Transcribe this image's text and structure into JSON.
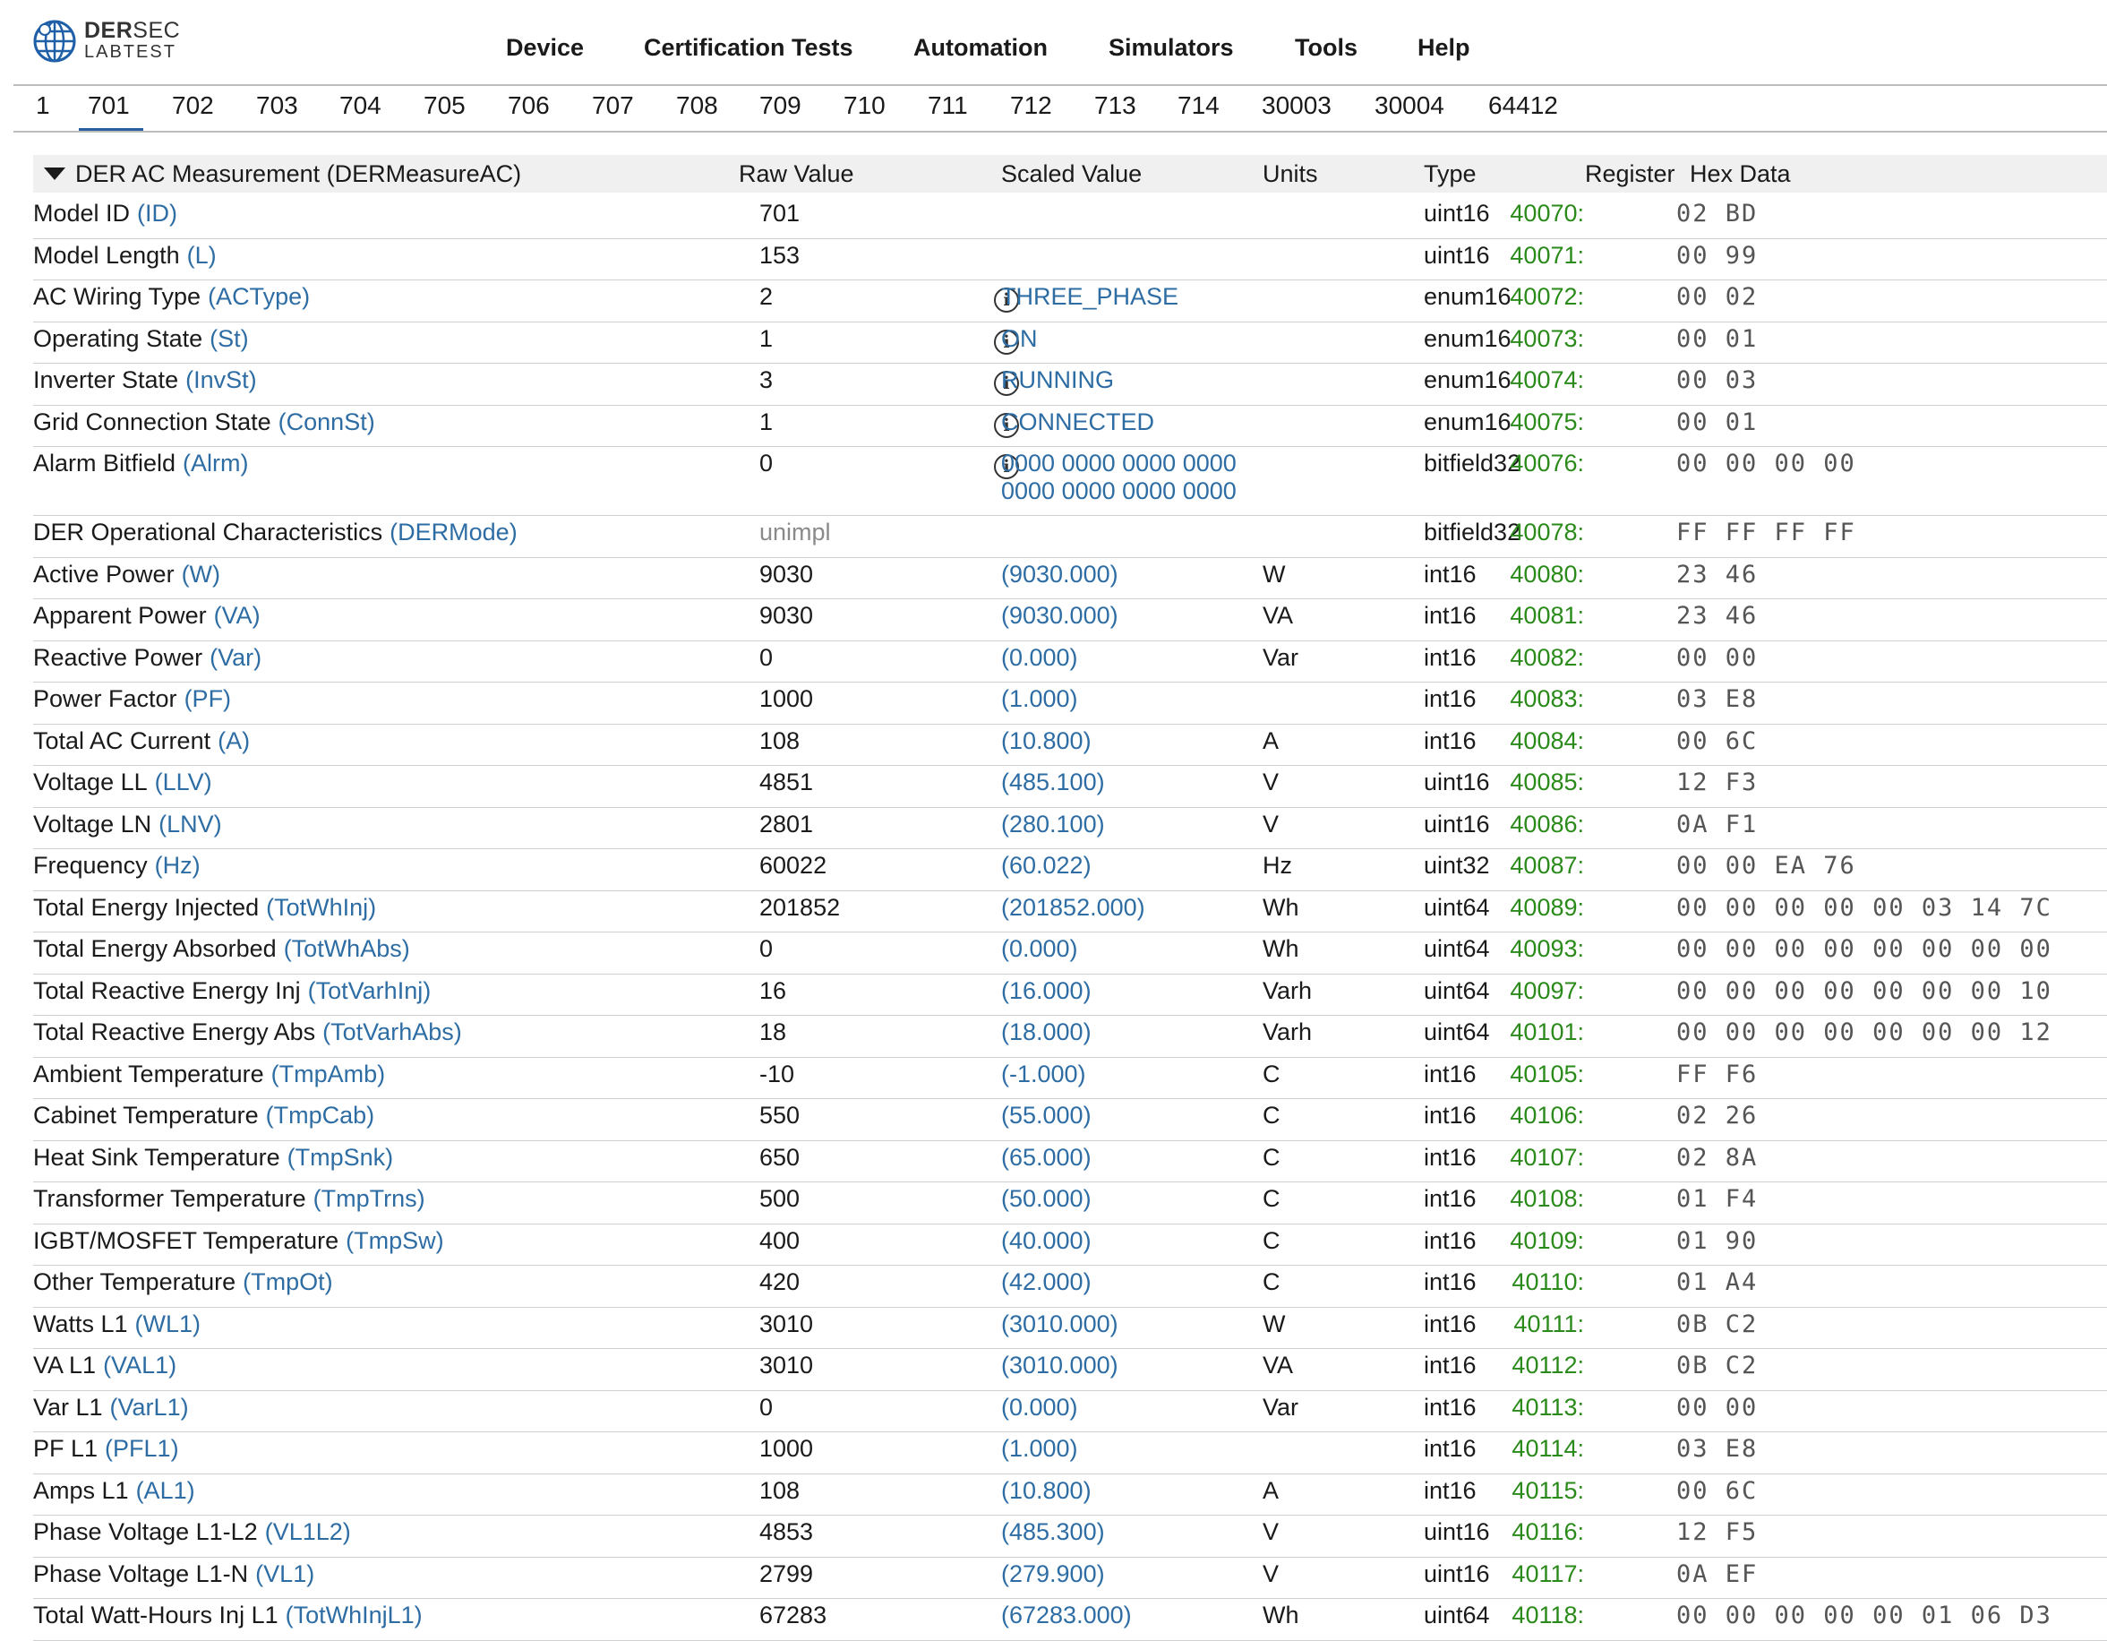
{
  "logo": {
    "line1_bold": "DER",
    "line1_light": "SEC",
    "line2": "LABTEST"
  },
  "nav": [
    "Device",
    "Certification Tests",
    "Automation",
    "Simulators",
    "Tools",
    "Help"
  ],
  "tabs": [
    "1",
    "701",
    "702",
    "703",
    "704",
    "705",
    "706",
    "707",
    "708",
    "709",
    "710",
    "711",
    "712",
    "713",
    "714",
    "30003",
    "30004",
    "64412"
  ],
  "active_tab": "701",
  "section": {
    "title": "DER AC Measurement (DERMeasureAC)",
    "columns": {
      "raw": "Raw Value",
      "scaled": "Scaled Value",
      "units": "Units",
      "type": "Type",
      "register": "Register",
      "hex": "Hex Data"
    }
  },
  "rows": [
    {
      "name": "Model ID",
      "id": "(ID)",
      "raw": "701",
      "scaled": "",
      "units": "",
      "type": "uint16",
      "reg": "40070:",
      "hex": "02 BD"
    },
    {
      "name": "Model Length",
      "id": "(L)",
      "raw": "153",
      "scaled": "",
      "units": "",
      "type": "uint16",
      "reg": "40071:",
      "hex": "00 99"
    },
    {
      "name": "AC Wiring Type",
      "id": "(ACType)",
      "raw": "2",
      "scaled": "THREE_PHASE",
      "info": true,
      "units": "",
      "type": "enum16",
      "reg": "40072:",
      "hex": "00 02"
    },
    {
      "name": "Operating State",
      "id": "(St)",
      "raw": "1",
      "scaled": "ON",
      "info": true,
      "units": "",
      "type": "enum16",
      "reg": "40073:",
      "hex": "00 01"
    },
    {
      "name": "Inverter State",
      "id": "(InvSt)",
      "raw": "3",
      "scaled": "RUNNING",
      "info": true,
      "units": "",
      "type": "enum16",
      "reg": "40074:",
      "hex": "00 03"
    },
    {
      "name": "Grid Connection State",
      "id": "(ConnSt)",
      "raw": "1",
      "scaled": "CONNECTED",
      "info": true,
      "units": "",
      "type": "enum16",
      "reg": "40075:",
      "hex": "00 01"
    },
    {
      "name": "Alarm Bitfield",
      "id": "(Alrm)",
      "raw": "0",
      "scaled": "0000 0000 0000 0000",
      "scaled2": "0000 0000 0000 0000",
      "info": true,
      "units": "",
      "type": "bitfield32",
      "reg": "40076:",
      "hex": "00 00 00 00"
    },
    {
      "name": "DER Operational Characteristics",
      "id": "(DERMode)",
      "raw": "unimpl",
      "unimpl": true,
      "scaled": "",
      "units": "",
      "type": "bitfield32",
      "reg": "40078:",
      "hex": "FF FF FF FF"
    },
    {
      "name": "Active Power",
      "id": "(W)",
      "raw": "9030",
      "scaled": "(9030.000)",
      "units": "W",
      "type": "int16",
      "reg": "40080:",
      "hex": "23 46"
    },
    {
      "name": "Apparent Power",
      "id": "(VA)",
      "raw": "9030",
      "scaled": "(9030.000)",
      "units": "VA",
      "type": "int16",
      "reg": "40081:",
      "hex": "23 46"
    },
    {
      "name": "Reactive Power",
      "id": "(Var)",
      "raw": "0",
      "scaled": "(0.000)",
      "units": "Var",
      "type": "int16",
      "reg": "40082:",
      "hex": "00 00"
    },
    {
      "name": "Power Factor",
      "id": "(PF)",
      "raw": "1000",
      "scaled": "(1.000)",
      "units": "",
      "type": "int16",
      "reg": "40083:",
      "hex": "03 E8"
    },
    {
      "name": "Total AC Current",
      "id": "(A)",
      "raw": "108",
      "scaled": "(10.800)",
      "units": "A",
      "type": "int16",
      "reg": "40084:",
      "hex": "00 6C"
    },
    {
      "name": "Voltage LL",
      "id": "(LLV)",
      "raw": "4851",
      "scaled": "(485.100)",
      "units": "V",
      "type": "uint16",
      "reg": "40085:",
      "hex": "12 F3"
    },
    {
      "name": "Voltage LN",
      "id": "(LNV)",
      "raw": "2801",
      "scaled": "(280.100)",
      "units": "V",
      "type": "uint16",
      "reg": "40086:",
      "hex": "0A F1"
    },
    {
      "name": "Frequency",
      "id": "(Hz)",
      "raw": "60022",
      "scaled": "(60.022)",
      "units": "Hz",
      "type": "uint32",
      "reg": "40087:",
      "hex": "00 00 EA 76"
    },
    {
      "name": "Total Energy Injected",
      "id": "(TotWhInj)",
      "raw": "201852",
      "scaled": "(201852.000)",
      "units": "Wh",
      "type": "uint64",
      "reg": "40089:",
      "hex": "00 00 00 00 00 03 14 7C"
    },
    {
      "name": "Total Energy Absorbed",
      "id": "(TotWhAbs)",
      "raw": "0",
      "scaled": "(0.000)",
      "units": "Wh",
      "type": "uint64",
      "reg": "40093:",
      "hex": "00 00 00 00 00 00 00 00"
    },
    {
      "name": "Total Reactive Energy Inj",
      "id": "(TotVarhInj)",
      "raw": "16",
      "scaled": "(16.000)",
      "units": "Varh",
      "type": "uint64",
      "reg": "40097:",
      "hex": "00 00 00 00 00 00 00 10"
    },
    {
      "name": "Total Reactive Energy Abs",
      "id": "(TotVarhAbs)",
      "raw": "18",
      "scaled": "(18.000)",
      "units": "Varh",
      "type": "uint64",
      "reg": "40101:",
      "hex": "00 00 00 00 00 00 00 12"
    },
    {
      "name": "Ambient Temperature",
      "id": "(TmpAmb)",
      "raw": "-10",
      "scaled": "(-1.000)",
      "units": "C",
      "type": "int16",
      "reg": "40105:",
      "hex": "FF F6"
    },
    {
      "name": "Cabinet Temperature",
      "id": "(TmpCab)",
      "raw": "550",
      "scaled": "(55.000)",
      "units": "C",
      "type": "int16",
      "reg": "40106:",
      "hex": "02 26"
    },
    {
      "name": "Heat Sink Temperature",
      "id": "(TmpSnk)",
      "raw": "650",
      "scaled": "(65.000)",
      "units": "C",
      "type": "int16",
      "reg": "40107:",
      "hex": "02 8A"
    },
    {
      "name": "Transformer Temperature",
      "id": "(TmpTrns)",
      "raw": "500",
      "scaled": "(50.000)",
      "units": "C",
      "type": "int16",
      "reg": "40108:",
      "hex": "01 F4"
    },
    {
      "name": "IGBT/MOSFET Temperature",
      "id": "(TmpSw)",
      "raw": "400",
      "scaled": "(40.000)",
      "units": "C",
      "type": "int16",
      "reg": "40109:",
      "hex": "01 90"
    },
    {
      "name": "Other Temperature",
      "id": "(TmpOt)",
      "raw": "420",
      "scaled": "(42.000)",
      "units": "C",
      "type": "int16",
      "reg": "40110:",
      "hex": "01 A4"
    },
    {
      "name": "Watts L1",
      "id": "(WL1)",
      "raw": "3010",
      "scaled": "(3010.000)",
      "units": "W",
      "type": "int16",
      "reg": "40111:",
      "hex": "0B C2"
    },
    {
      "name": "VA L1",
      "id": "(VAL1)",
      "raw": "3010",
      "scaled": "(3010.000)",
      "units": "VA",
      "type": "int16",
      "reg": "40112:",
      "hex": "0B C2"
    },
    {
      "name": "Var L1",
      "id": "(VarL1)",
      "raw": "0",
      "scaled": "(0.000)",
      "units": "Var",
      "type": "int16",
      "reg": "40113:",
      "hex": "00 00"
    },
    {
      "name": "PF L1",
      "id": "(PFL1)",
      "raw": "1000",
      "scaled": "(1.000)",
      "units": "",
      "type": "int16",
      "reg": "40114:",
      "hex": "03 E8"
    },
    {
      "name": "Amps L1",
      "id": "(AL1)",
      "raw": "108",
      "scaled": "(10.800)",
      "units": "A",
      "type": "int16",
      "reg": "40115:",
      "hex": "00 6C"
    },
    {
      "name": "Phase Voltage L1-L2",
      "id": "(VL1L2)",
      "raw": "4853",
      "scaled": "(485.300)",
      "units": "V",
      "type": "uint16",
      "reg": "40116:",
      "hex": "12 F5"
    },
    {
      "name": "Phase Voltage L1-N",
      "id": "(VL1)",
      "raw": "2799",
      "scaled": "(279.900)",
      "units": "V",
      "type": "uint16",
      "reg": "40117:",
      "hex": "0A EF"
    },
    {
      "name": "Total Watt-Hours Inj L1",
      "id": "(TotWhInjL1)",
      "raw": "67283",
      "scaled": "(67283.000)",
      "units": "Wh",
      "type": "uint64",
      "reg": "40118:",
      "hex": "00 00 00 00 00 01 06 D3"
    }
  ]
}
